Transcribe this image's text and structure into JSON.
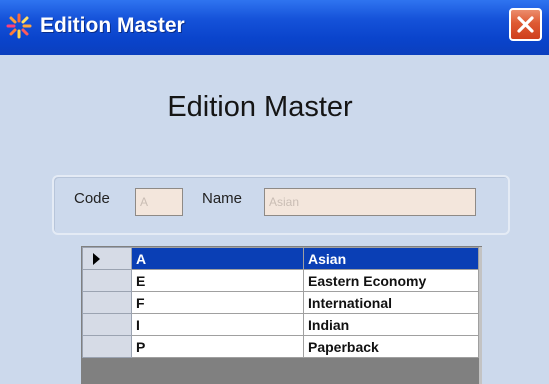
{
  "window": {
    "title": "Edition Master",
    "icon": "sparkle-app-icon",
    "close_icon": "close-x-icon"
  },
  "form": {
    "heading": "Edition Master",
    "code_label": "Code",
    "code_value": "A",
    "name_label": "Name",
    "name_value": "Asian"
  },
  "grid": {
    "rows": [
      {
        "code": "A",
        "name": "Asian",
        "selected": true
      },
      {
        "code": "E",
        "name": "Eastern Economy",
        "selected": false
      },
      {
        "code": "F",
        "name": "International",
        "selected": false
      },
      {
        "code": "I",
        "name": "Indian",
        "selected": false
      },
      {
        "code": "P",
        "name": "Paperback",
        "selected": false
      }
    ]
  },
  "colors": {
    "titlebar": "#0a44cc",
    "selection": "#0a3fb5",
    "close_button": "#de5a33",
    "input_background": "#f3e6dc"
  }
}
